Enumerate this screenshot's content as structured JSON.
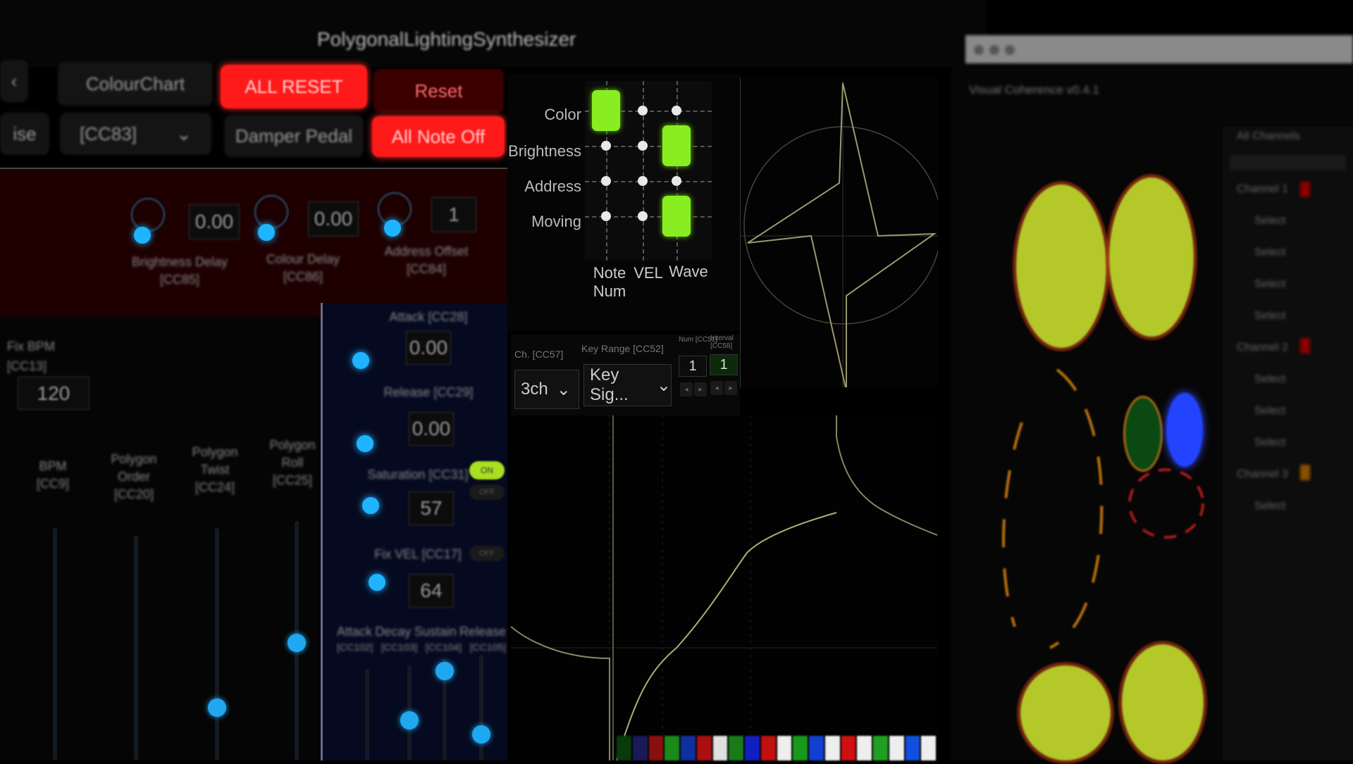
{
  "app": {
    "title": "PolygonalLightingSynthesizer"
  },
  "toolbar": {
    "colour_chart": "ColourChart",
    "all_reset": "ALL RESET",
    "reset": "Reset",
    "left_stub": "ise",
    "cc_select": "[CC83]",
    "damper_pedal": "Damper Pedal",
    "all_note_off": "All Note Off"
  },
  "delays": {
    "brightness_delay": {
      "label": "Brightness Delay",
      "cc": "[CC85]",
      "value": "0.00"
    },
    "colour_delay": {
      "label": "Colour Delay",
      "cc": "[CC86]",
      "value": "0.00"
    },
    "address_offset": {
      "label": "Address Offset",
      "cc": "[CC84]",
      "value": "1"
    }
  },
  "left_panel": {
    "fix_bpm": "Fix BPM",
    "bpm_cc": "[CC13]",
    "bpm_value": "120",
    "sliders": [
      {
        "label": "BPM",
        "cc": "[CC9]",
        "level": 0.0
      },
      {
        "label": "Polygon Order",
        "cc": "[CC20]",
        "level": 0.0
      },
      {
        "label": "Polygon Twist",
        "cc": "[CC24]",
        "level": 0.25
      },
      {
        "label": "Polygon Roll",
        "cc": "[CC25]",
        "level": 0.45
      }
    ]
  },
  "blue_panel": {
    "rows": [
      {
        "label": "Attack",
        "cc": "[CC28]",
        "value": "0.00"
      },
      {
        "label": "Release",
        "cc": "[CC29]",
        "value": "0.00"
      },
      {
        "label": "Saturation",
        "cc": "[CC31]",
        "value": "57"
      },
      {
        "label": "Fix VEL",
        "cc": "[CC17]",
        "value": "64"
      }
    ],
    "toggle_on": "ON",
    "toggle_off": "OFF",
    "adsr": [
      "Attack",
      "Decay",
      "Sustain",
      "Release"
    ],
    "adsr_cc": [
      "[CC102]",
      "[CC103]",
      "[CC104]",
      "[CC105]"
    ]
  },
  "matrix": {
    "rows": [
      "Color",
      "Brightness",
      "Address",
      "Moving"
    ],
    "cols": [
      "Note Num",
      "VEL",
      "Wave"
    ],
    "col_note_1": "Note",
    "col_note_2": "Num",
    "active": [
      [
        0,
        0
      ],
      [
        1,
        2
      ],
      [
        3,
        2
      ]
    ],
    "on_color": "#88ee22"
  },
  "controls": {
    "ch_label": "Ch. [CC57]",
    "ch_value": "3ch",
    "key_range_label": "Key Range [CC52]",
    "key_range_value": "Key Sig...",
    "num_label": "Num [CC51]",
    "num_value": "1",
    "interval_label": "Interval [CC58]",
    "interval_value": "1"
  },
  "visual": {
    "title": "Visual Coherence v0.4.1",
    "list_header": "All Channels",
    "list_items": [
      "Channel 1",
      "Select",
      "Select",
      "Select",
      "Select",
      "Channel 2",
      "Select",
      "Select",
      "Select",
      "Channel 3",
      "Select"
    ]
  },
  "colors": {
    "accent_red": "#ff1a1a",
    "knob_blue": "#1fb4ff",
    "matrix_green": "#88ee22",
    "circle_yellow": "#b4c82a"
  }
}
